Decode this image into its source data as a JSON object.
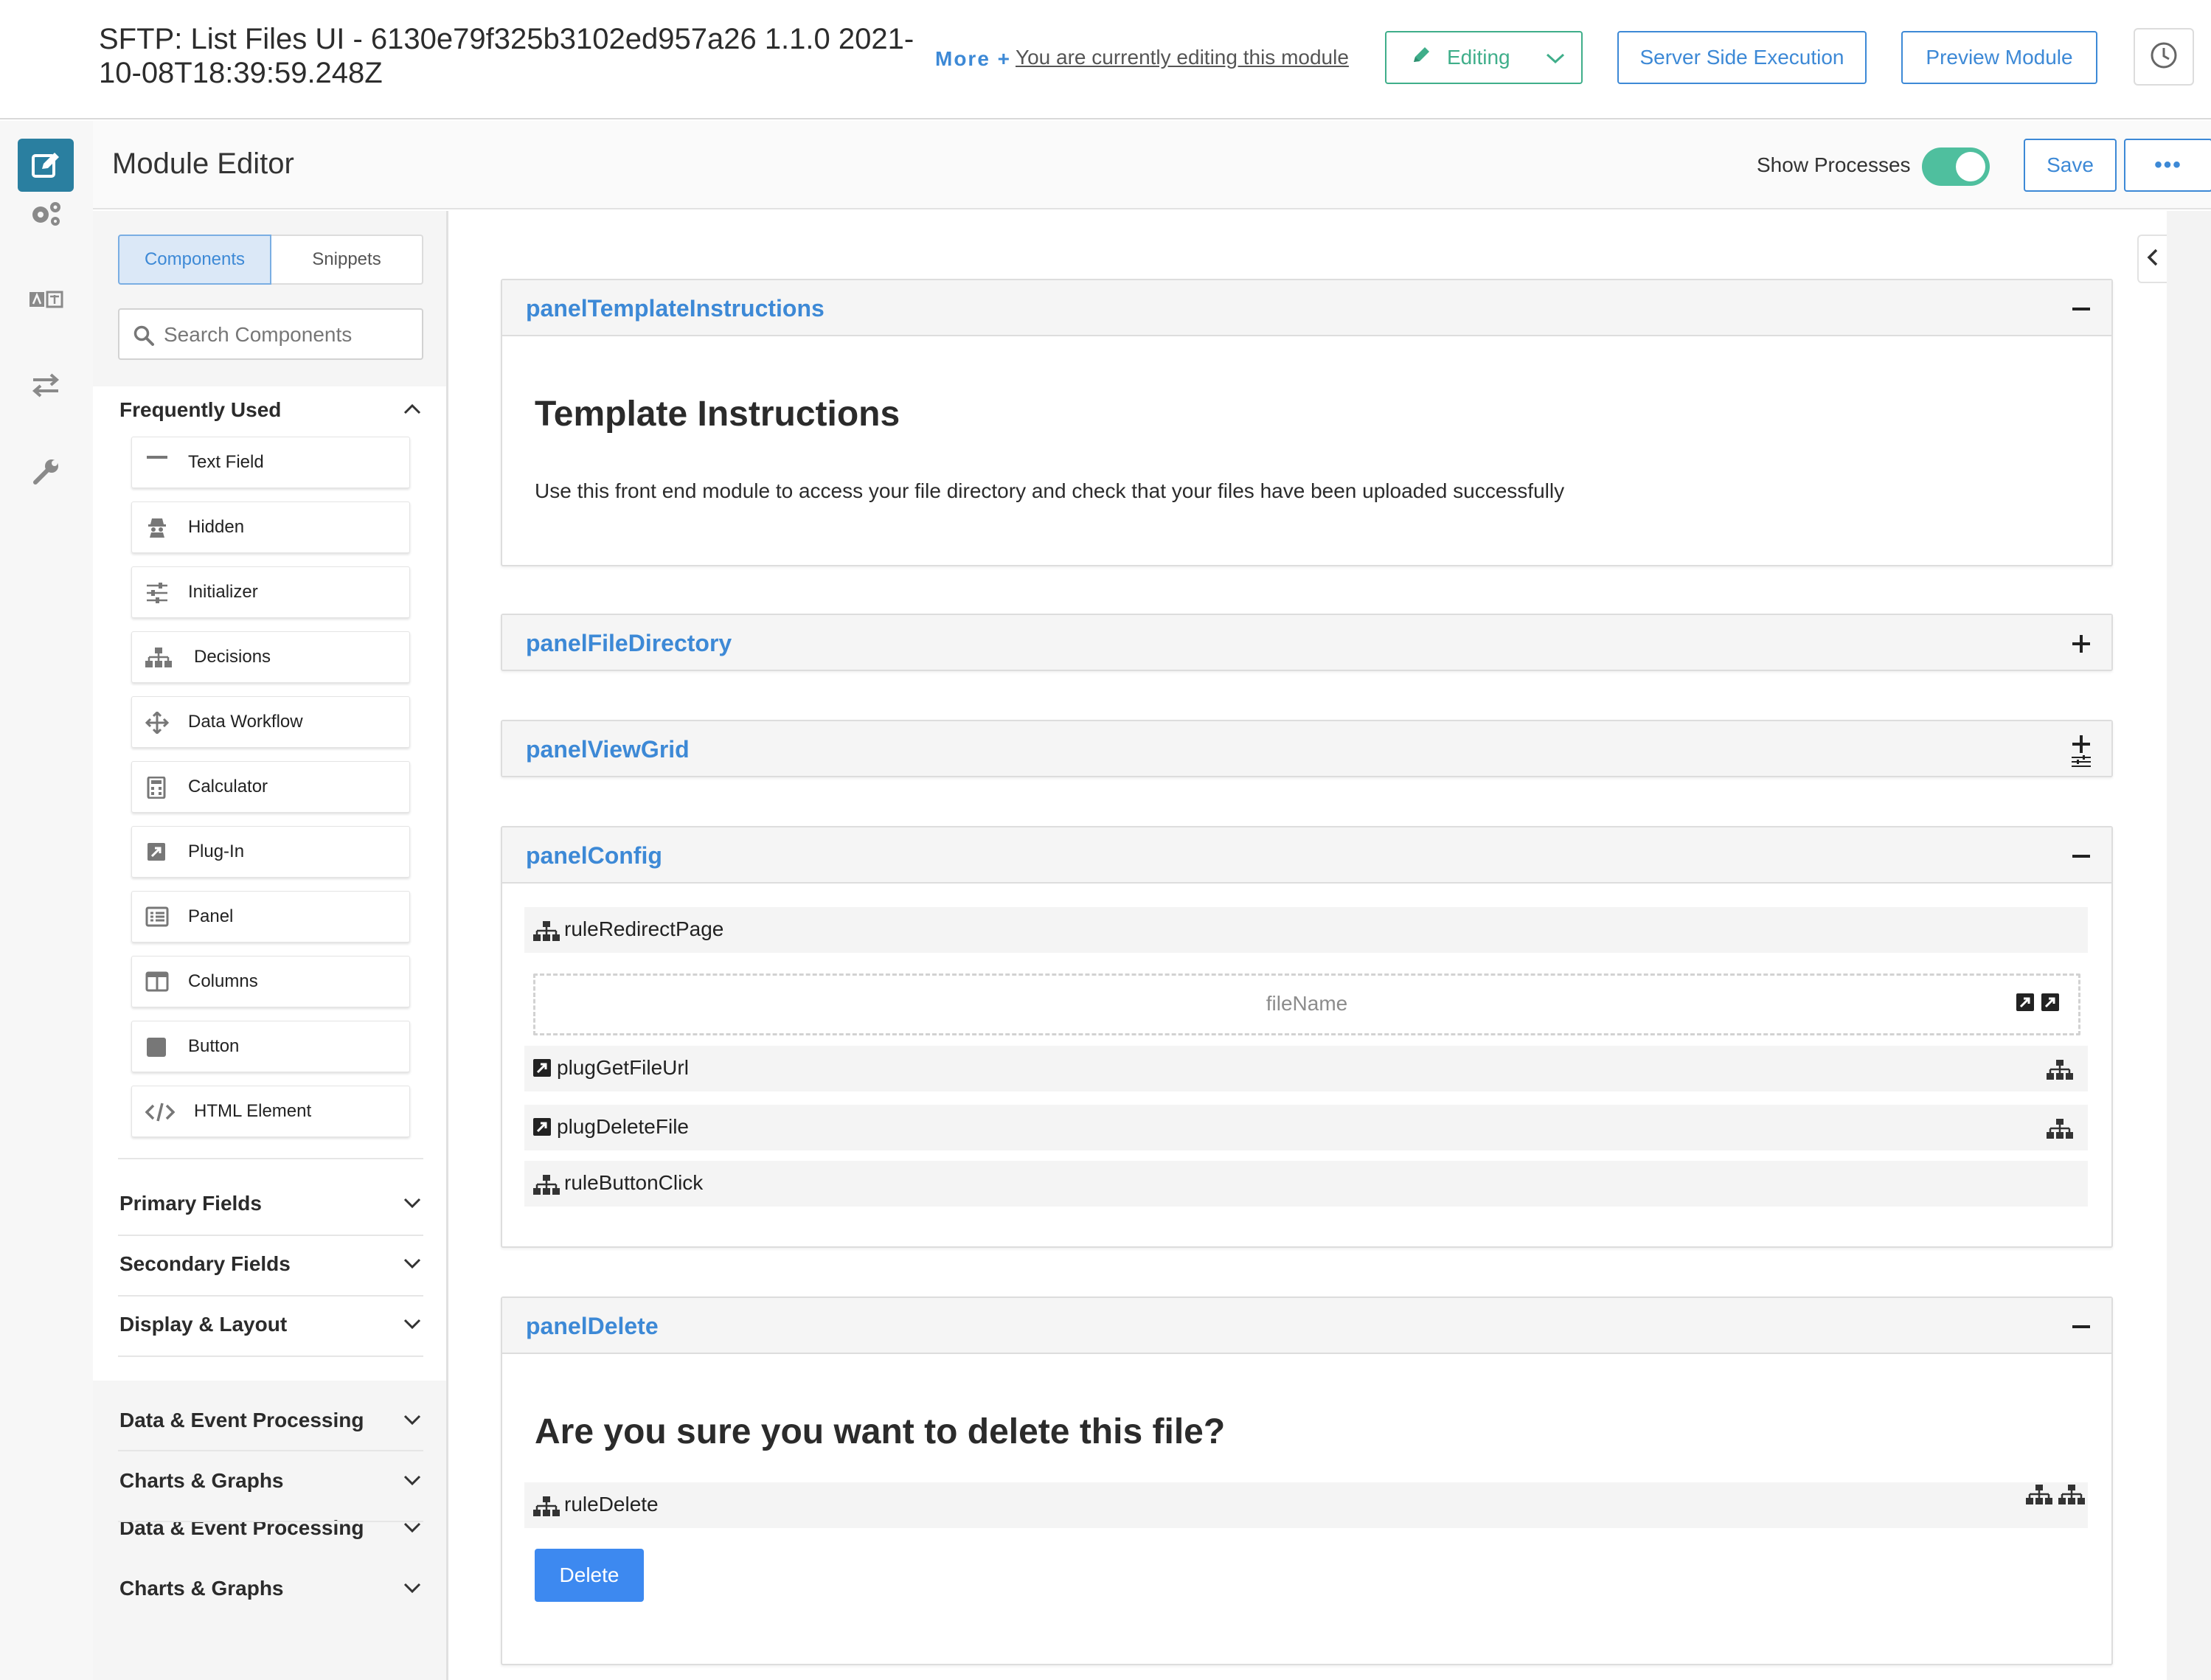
{
  "header": {
    "title": "SFTP: List Files UI - 6130e79f325b3102ed957a26 1.1.0 2021-10-08T18:39:59.248Z",
    "more_label": "More +",
    "editing_note": "You are currently editing this module",
    "editing_label": "Editing",
    "server_side_label": "Server Side Execution",
    "preview_label": "Preview Module",
    "history_icon": "clock-icon"
  },
  "rail": {
    "icons": [
      "edit-icon",
      "gears-icon",
      "translate-icon",
      "transfer-arrows-icon",
      "wrench-icon"
    ]
  },
  "editor": {
    "title": "Module Editor",
    "show_processes_label": "Show Processes",
    "show_processes_on": true,
    "save_label": "Save",
    "more_label": "•••"
  },
  "sidebar": {
    "tabs": [
      {
        "label": "Components",
        "active": true
      },
      {
        "label": "Snippets",
        "active": false
      }
    ],
    "search": {
      "placeholder": "Search Components",
      "value": ""
    },
    "frequently_used": {
      "title": "Frequently Used",
      "items": [
        {
          "label": "Text Field",
          "icon": "text-field-icon"
        },
        {
          "label": "Hidden",
          "icon": "spy-icon"
        },
        {
          "label": "Initializer",
          "icon": "sliders-icon"
        },
        {
          "label": "Decisions",
          "icon": "sitemap-icon"
        },
        {
          "label": "Data Workflow",
          "icon": "arrows-move-icon"
        },
        {
          "label": "Calculator",
          "icon": "calculator-icon"
        },
        {
          "label": "Plug-In",
          "icon": "plugin-icon"
        },
        {
          "label": "Panel",
          "icon": "list-panel-icon"
        },
        {
          "label": "Columns",
          "icon": "columns-icon"
        },
        {
          "label": "Button",
          "icon": "button-square-icon"
        },
        {
          "label": "HTML Element",
          "icon": "code-icon"
        }
      ]
    },
    "sections": [
      "Primary Fields",
      "Secondary Fields",
      "Display & Layout",
      "Data & Event Processing",
      "Charts & Graphs",
      "Data & Event Processing",
      "Charts & Graphs"
    ]
  },
  "canvas": {
    "panels": {
      "template": {
        "title": "panelTemplateInstructions",
        "heading": "Template Instructions",
        "text": "Use this front end module to access your file directory and check that your files have been uploaded successfully"
      },
      "file_directory": {
        "title": "panelFileDirectory"
      },
      "view_grid": {
        "title": "panelViewGrid"
      },
      "config": {
        "title": "panelConfig",
        "rows": {
          "rule_redirect": "ruleRedirectPage",
          "file_name": "fileName",
          "plug_get": "plugGetFileUrl",
          "plug_delete": "plugDeleteFile",
          "rule_button": "ruleButtonClick"
        }
      },
      "delete": {
        "title": "panelDelete",
        "heading": "Are you sure you want to delete this file?",
        "rule": "ruleDelete",
        "button_label": "Delete"
      }
    }
  },
  "colors": {
    "accent_blue": "#3d89d6",
    "editing_green": "#3fae8a",
    "toggle_on": "#4fbf9e",
    "rail_active": "#2a7fa0",
    "delete_button": "#3d89f0"
  }
}
